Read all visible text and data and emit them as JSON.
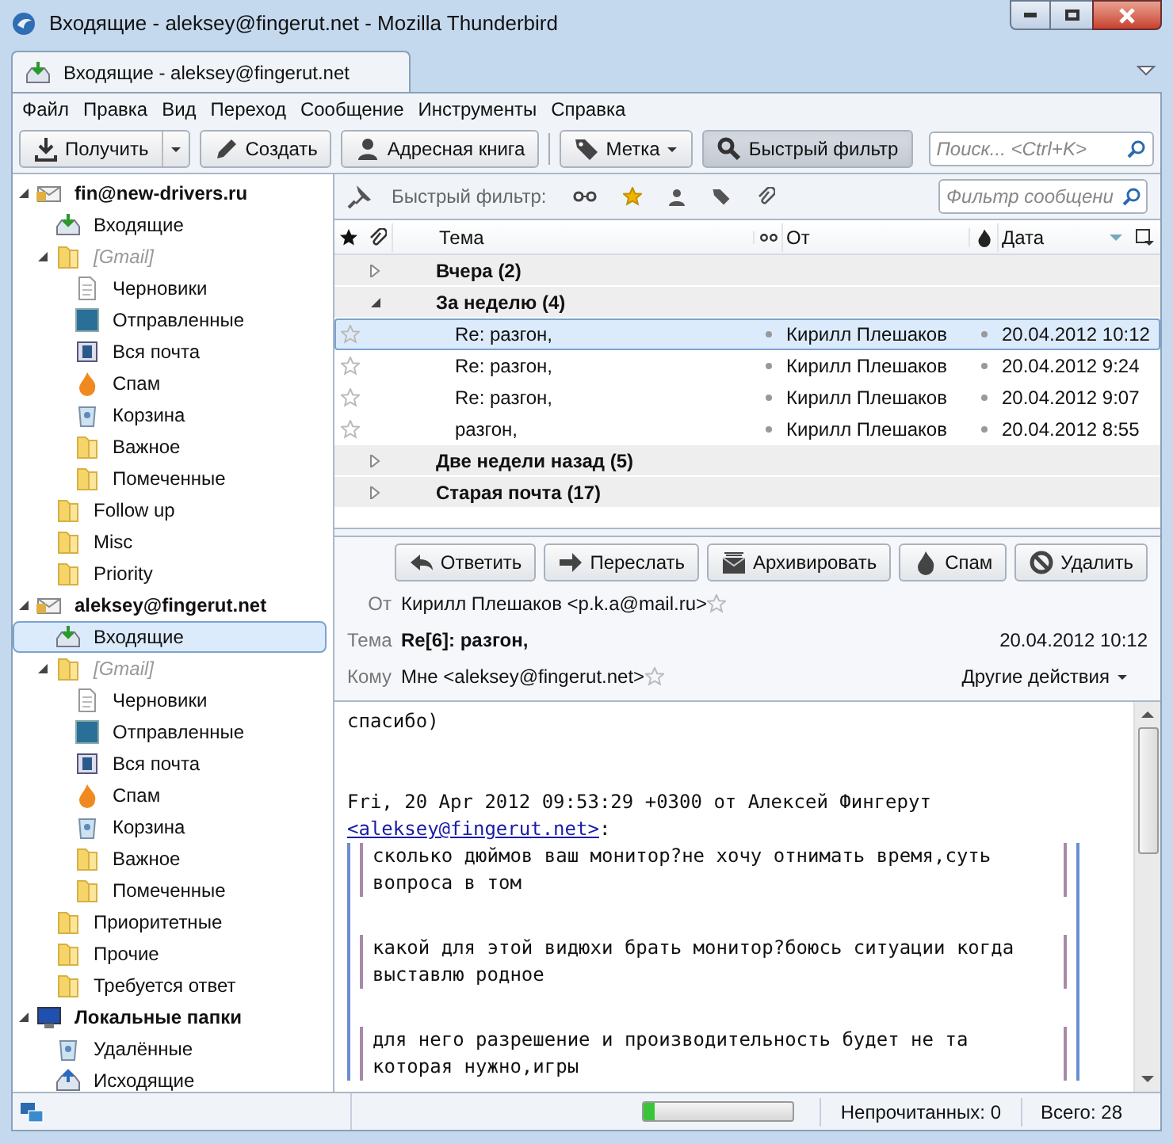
{
  "window": {
    "title": "Входящие - aleksey@fingerut.net - Mozilla Thunderbird"
  },
  "tabs": [
    {
      "label": "Входящие - aleksey@fingerut.net",
      "selected": true
    }
  ],
  "menu": [
    "Файл",
    "Правка",
    "Вид",
    "Переход",
    "Сообщение",
    "Инструменты",
    "Справка"
  ],
  "toolbar": [
    {
      "kind": "get",
      "label": "Получить",
      "dropdown": true,
      "split": true,
      "pressed": false
    },
    {
      "kind": "write",
      "label": "Создать",
      "dropdown": false,
      "split": false,
      "pressed": false
    },
    {
      "kind": "addressbook",
      "label": "Адресная книга",
      "dropdown": false,
      "split": false,
      "pressed": false
    },
    {
      "kind": "tag",
      "label": "Метка",
      "dropdown": true,
      "split": false,
      "pressed": false
    },
    {
      "kind": "quickfilter",
      "label": "Быстрый фильтр",
      "dropdown": false,
      "split": false,
      "pressed": true
    }
  ],
  "search": {
    "placeholder": "Поиск... <Ctrl+K>"
  },
  "folders": [
    {
      "kind": "account",
      "label": "fin@new-drivers.ru",
      "expanded": true,
      "selected": false,
      "children": [
        {
          "kind": "inbox",
          "label": "Входящие",
          "selected": false
        },
        {
          "kind": "virtual",
          "label": "[Gmail]",
          "expanded": true,
          "selected": false,
          "children": [
            {
              "kind": "drafts",
              "label": "Черновики",
              "selected": false
            },
            {
              "kind": "sent",
              "label": "Отправленные",
              "selected": false
            },
            {
              "kind": "all",
              "label": "Вся почта",
              "selected": false
            },
            {
              "kind": "spam",
              "label": "Спам",
              "selected": false
            },
            {
              "kind": "trash",
              "label": "Корзина",
              "selected": false
            },
            {
              "kind": "folder",
              "label": "Важное",
              "selected": false
            },
            {
              "kind": "folder",
              "label": "Помеченные",
              "selected": false
            }
          ]
        },
        {
          "kind": "folder",
          "label": "Follow up",
          "selected": false
        },
        {
          "kind": "folder",
          "label": "Misc",
          "selected": false
        },
        {
          "kind": "folder",
          "label": "Priority",
          "selected": false
        }
      ]
    },
    {
      "kind": "account",
      "label": "aleksey@fingerut.net",
      "expanded": true,
      "selected": false,
      "children": [
        {
          "kind": "inbox",
          "label": "Входящие",
          "selected": true
        },
        {
          "kind": "virtual",
          "label": "[Gmail]",
          "expanded": true,
          "selected": false,
          "children": [
            {
              "kind": "drafts",
              "label": "Черновики",
              "selected": false
            },
            {
              "kind": "sent",
              "label": "Отправленные",
              "selected": false
            },
            {
              "kind": "all",
              "label": "Вся почта",
              "selected": false
            },
            {
              "kind": "spam",
              "label": "Спам",
              "selected": false
            },
            {
              "kind": "trash",
              "label": "Корзина",
              "selected": false
            },
            {
              "kind": "folder",
              "label": "Важное",
              "selected": false
            },
            {
              "kind": "folder",
              "label": "Помеченные",
              "selected": false
            }
          ]
        },
        {
          "kind": "folder",
          "label": "Приоритетные",
          "selected": false
        },
        {
          "kind": "folder",
          "label": "Прочие",
          "selected": false
        },
        {
          "kind": "folder",
          "label": "Требуется ответ",
          "selected": false
        }
      ]
    },
    {
      "kind": "local",
      "label": "Локальные папки",
      "expanded": true,
      "selected": false,
      "children": [
        {
          "kind": "trash",
          "label": "Удалённые",
          "selected": false
        },
        {
          "kind": "outbox",
          "label": "Исходящие",
          "selected": false
        }
      ]
    }
  ],
  "quick_filter": {
    "label": "Быстрый фильтр:",
    "placeholder": "Фильтр сообщени"
  },
  "columns": {
    "subject": "Тема",
    "from": "От",
    "date": "Дата"
  },
  "groups": [
    {
      "label": "Вчера (2)",
      "expanded": false
    },
    {
      "label": "За неделю (4)",
      "expanded": true,
      "messages": [
        {
          "subject": "Re: разгон,",
          "from": "Кирилл Плешаков",
          "date": "20.04.2012 10:12",
          "selected": true,
          "starred": false
        },
        {
          "subject": "Re: разгон,",
          "from": "Кирилл Плешаков",
          "date": "20.04.2012 9:24",
          "selected": false,
          "starred": false
        },
        {
          "subject": "Re: разгон,",
          "from": "Кирилл Плешаков",
          "date": "20.04.2012 9:07",
          "selected": false,
          "starred": false
        },
        {
          "subject": "разгон,",
          "from": "Кирилл Плешаков",
          "date": "20.04.2012 8:55",
          "selected": false,
          "starred": false
        }
      ]
    },
    {
      "label": "Две недели назад (5)",
      "expanded": false
    },
    {
      "label": "Старая почта (17)",
      "expanded": false
    }
  ],
  "header_buttons": [
    {
      "kind": "reply",
      "label": "Ответить"
    },
    {
      "kind": "forward",
      "label": "Переслать"
    },
    {
      "kind": "archive",
      "label": "Архивировать"
    },
    {
      "kind": "spam",
      "label": "Спам"
    },
    {
      "kind": "delete",
      "label": "Удалить"
    }
  ],
  "message": {
    "from_label": "От",
    "from": "Кирилл Плешаков <p.k.a@mail.ru>",
    "subject_label": "Тема",
    "subject": "Re[6]: разгон,",
    "date": "20.04.2012 10:12",
    "to_label": "Кому",
    "to": "Мне <aleksey@fingerut.net>",
    "other_actions": "Другие действия"
  },
  "body": {
    "greeting": "спасибо)",
    "attribution": "Fri, 20 Apr 2012 09:53:29 +0300 от Алексей Фингерут",
    "attribution_link": "<aleksey@fingerut.net>",
    "attribution_end": ":",
    "quotes": [
      "сколько дюймов ваш монитор?не хочу отнимать время,суть вопроса в том",
      "какой для этой видюхи брать монитор?боюсь ситуации когда выставлю родное",
      "для него разрешение и производительность будет не та которая нужно,игры"
    ]
  },
  "status_bar": {
    "level": 0.07,
    "unread": "Непрочитанных: 0",
    "total": "Всего: 28"
  }
}
